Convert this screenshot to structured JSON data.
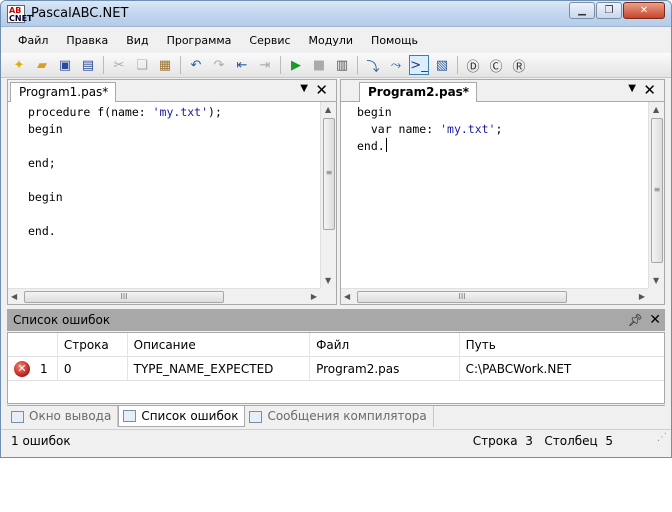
{
  "window": {
    "title": "PascalABC.NET",
    "icon_text_top": "AB",
    "icon_text_bottom": "CNET"
  },
  "menu": [
    "Файл",
    "Правка",
    "Вид",
    "Программа",
    "Сервис",
    "Модули",
    "Помощь"
  ],
  "editor_left": {
    "tab_label": "Program1.pas*",
    "lines": [
      [
        {
          "t": "procedure f(name: ",
          "c": "plain"
        },
        {
          "t": "'my.txt'",
          "c": "str"
        },
        {
          "t": ");",
          "c": "plain"
        }
      ],
      [
        {
          "t": "begin",
          "c": "plain"
        }
      ],
      [
        {
          "t": "",
          "c": "plain"
        }
      ],
      [
        {
          "t": "end;",
          "c": "plain"
        }
      ],
      [
        {
          "t": "",
          "c": "plain"
        }
      ],
      [
        {
          "t": "begin",
          "c": "plain"
        }
      ],
      [
        {
          "t": "",
          "c": "plain"
        }
      ],
      [
        {
          "t": "end.",
          "c": "plain"
        }
      ]
    ]
  },
  "editor_right": {
    "tab_label": "Program2.pas*",
    "lines": [
      [
        {
          "t": "begin",
          "c": "plain"
        }
      ],
      [
        {
          "t": "  var name: ",
          "c": "plain"
        },
        {
          "t": "'my.txt'",
          "c": "str"
        },
        {
          "t": ";",
          "c": "plain"
        }
      ],
      [
        {
          "t": "end.",
          "c": "plain"
        }
      ]
    ],
    "cursor": {
      "line": 3,
      "column": 5
    }
  },
  "error_panel": {
    "title": "Список ошибок",
    "columns": [
      "",
      "Строка",
      "Описание",
      "Файл",
      "Путь"
    ],
    "rows": [
      {
        "num": "1",
        "line": "0",
        "description": "TYPE_NAME_EXPECTED",
        "file": "Program2.pas",
        "path": "C:\\PABCWork.NET"
      }
    ]
  },
  "bottom_tabs": [
    {
      "label": "Окно вывода",
      "active": false
    },
    {
      "label": "Список ошибок",
      "active": true
    },
    {
      "label": "Сообщения компилятора",
      "active": false
    }
  ],
  "status": {
    "errors": "1 ошибок",
    "line_label": "Строка",
    "line_value": "3",
    "col_label": "Столбец",
    "col_value": "5"
  },
  "colors": {
    "string_literal": "#1a1aa6",
    "error_icon": "#c0201a",
    "panel_header": "#a8a8a8"
  }
}
